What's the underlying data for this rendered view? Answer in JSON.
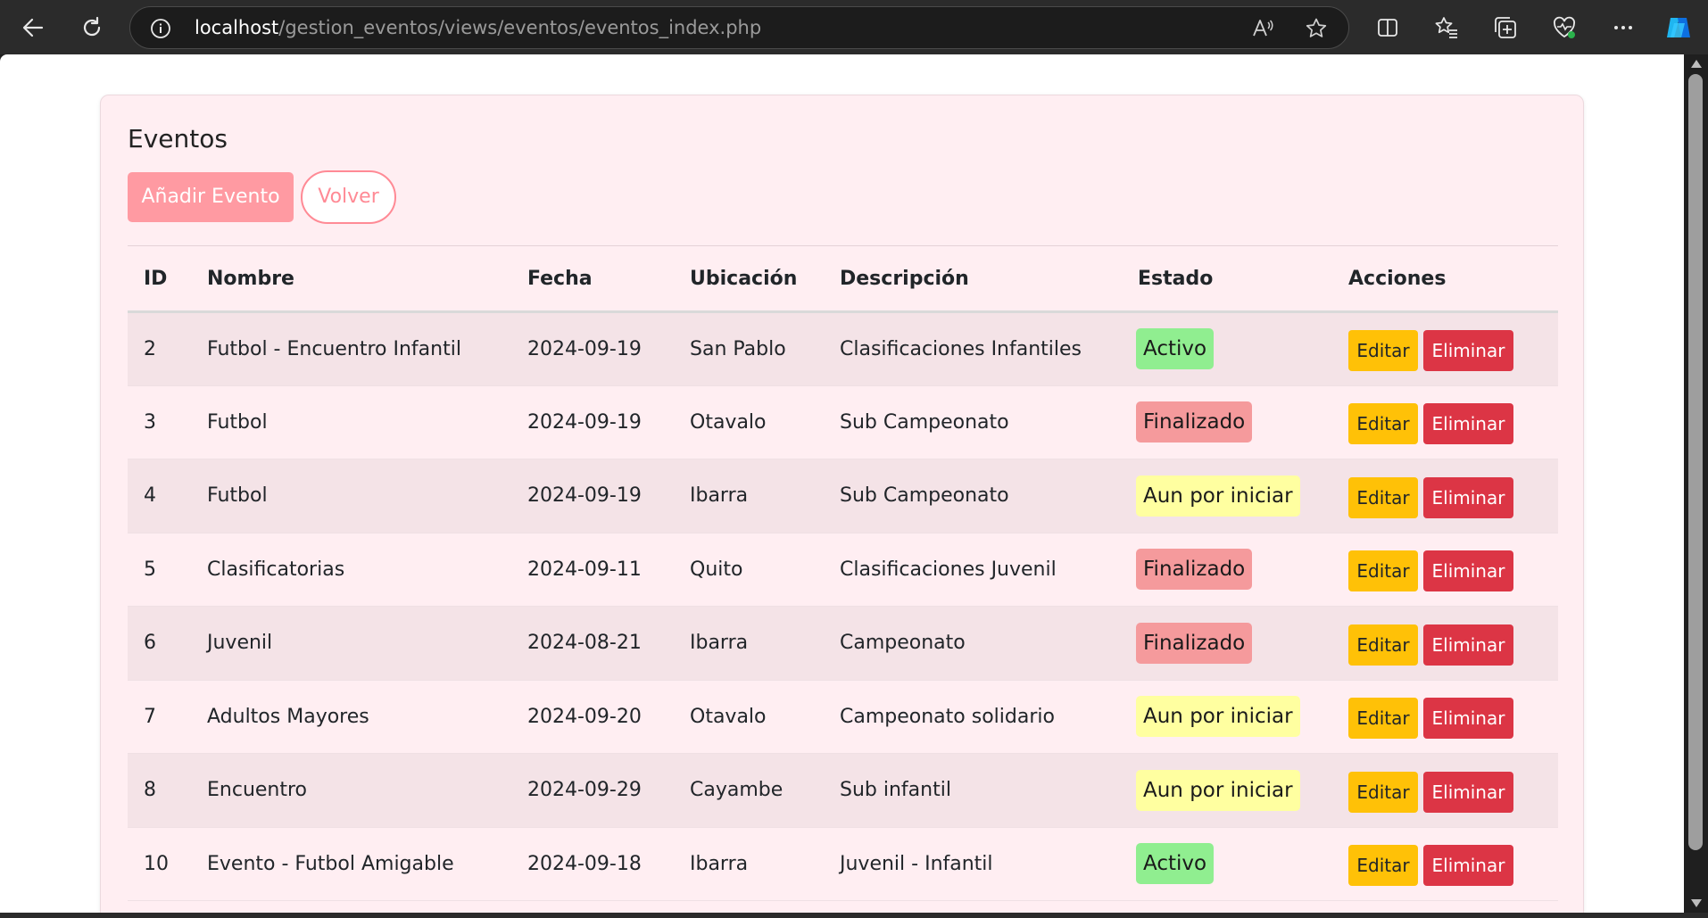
{
  "browser": {
    "url_host": "localhost",
    "url_path": "/gestion_eventos/views/eventos/eventos_index.php",
    "icons": [
      "back-arrow-icon",
      "refresh-icon",
      "info-icon",
      "read-aloud-icon",
      "favorite-star-icon",
      "split-screen-icon",
      "favorites-icon",
      "collections-icon",
      "browser-essentials-icon",
      "more-icon",
      "copilot-icon"
    ]
  },
  "page": {
    "title": "Eventos",
    "add_button": "Añadir Evento",
    "back_button": "Volver"
  },
  "table": {
    "headers": [
      "ID",
      "Nombre",
      "Fecha",
      "Ubicación",
      "Descripción",
      "Estado",
      "Acciones"
    ],
    "edit_label": "Editar",
    "delete_label": "Eliminar",
    "status_colors": {
      "Activo": "#90ee90",
      "Finalizado": "#f59a9c",
      "Aun por iniciar": "#ffffa0"
    },
    "rows": [
      {
        "id": "2",
        "nombre": "Futbol - Encuentro Infantil",
        "fecha": "2024-09-19",
        "ubicacion": "San Pablo",
        "descripcion": "Clasificaciones Infantiles",
        "estado": "Activo"
      },
      {
        "id": "3",
        "nombre": "Futbol",
        "fecha": "2024-09-19",
        "ubicacion": "Otavalo",
        "descripcion": "Sub Campeonato",
        "estado": "Finalizado"
      },
      {
        "id": "4",
        "nombre": "Futbol",
        "fecha": "2024-09-19",
        "ubicacion": "Ibarra",
        "descripcion": "Sub Campeonato",
        "estado": "Aun por iniciar"
      },
      {
        "id": "5",
        "nombre": "Clasificatorias",
        "fecha": "2024-09-11",
        "ubicacion": "Quito",
        "descripcion": "Clasificaciones Juvenil",
        "estado": "Finalizado"
      },
      {
        "id": "6",
        "nombre": "Juvenil",
        "fecha": "2024-08-21",
        "ubicacion": "Ibarra",
        "descripcion": "Campeonato",
        "estado": "Finalizado"
      },
      {
        "id": "7",
        "nombre": "Adultos Mayores",
        "fecha": "2024-09-20",
        "ubicacion": "Otavalo",
        "descripcion": "Campeonato solidario",
        "estado": "Aun por iniciar"
      },
      {
        "id": "8",
        "nombre": "Encuentro",
        "fecha": "2024-09-29",
        "ubicacion": "Cayambe",
        "descripcion": "Sub infantil",
        "estado": "Aun por iniciar"
      },
      {
        "id": "10",
        "nombre": "Evento - Futbol Amigable",
        "fecha": "2024-09-18",
        "ubicacion": "Ibarra",
        "descripcion": "Juvenil - Infantil",
        "estado": "Activo"
      }
    ]
  }
}
